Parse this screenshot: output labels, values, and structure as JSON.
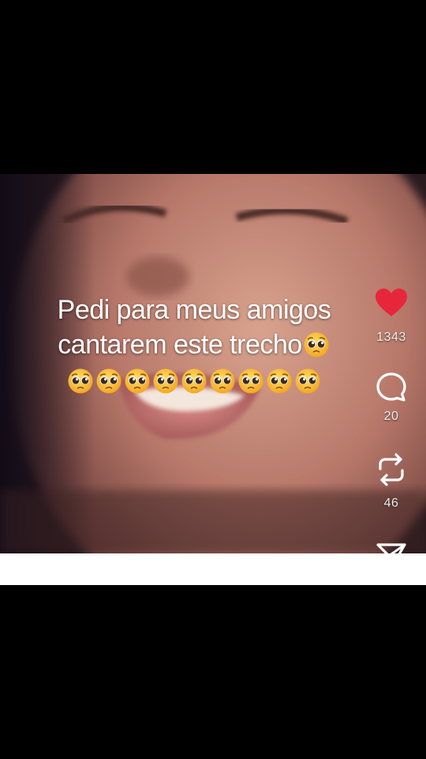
{
  "post": {
    "caption_line1": "Pedi para meus amigos",
    "caption_line2": "cantarem este trecho",
    "caption_emoji_name": "pleading-face-emoji",
    "caption_emoji_count_line2": 1,
    "caption_emoji_count_line3": 9
  },
  "actions": {
    "like": {
      "icon": "heart-icon",
      "count": "1343",
      "color": "#e8263b",
      "liked": true
    },
    "comment": {
      "icon": "comment-bubble-icon",
      "count": "20"
    },
    "repost": {
      "icon": "repost-icon",
      "count": "46"
    },
    "share": {
      "icon": "send-icon"
    }
  },
  "colors": {
    "background": "#000000",
    "caption_text": "#ffffff",
    "like_red": "#e8263b",
    "strip": "#ffffff"
  }
}
